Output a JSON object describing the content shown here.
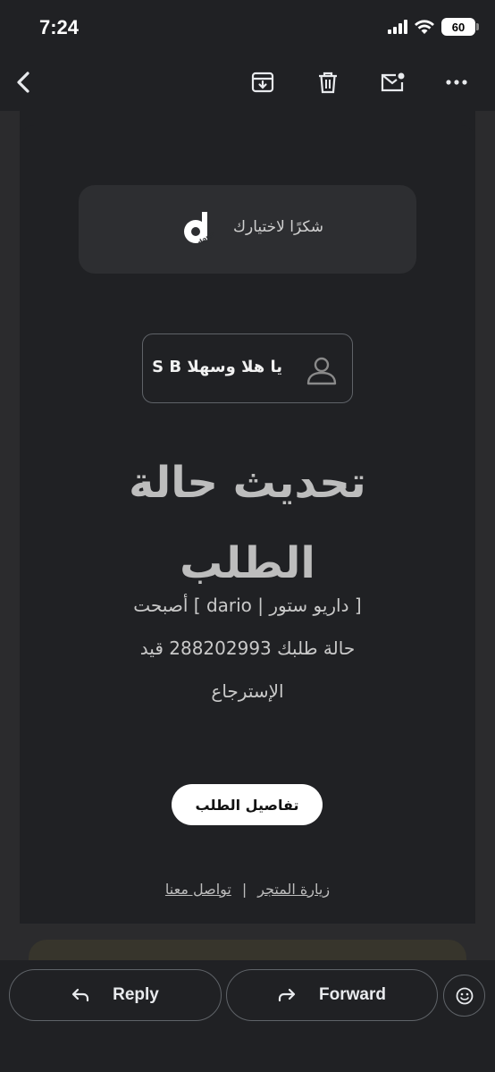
{
  "status_bar": {
    "time": "7:24",
    "battery": "60"
  },
  "email": {
    "brand_tagline": "شكرًا لاختيارك",
    "brand_logo_text": "dario",
    "greeting": "يا هلا وسهلا S B",
    "heading_line1": "تحديث حالة",
    "heading_line2": "الطلب",
    "body_line1": "[ داريو ستور | dario ] أصبحت",
    "body_line2": "حالة طلبك 288202993 قيد",
    "body_line3": "الإسترجاع",
    "details_button": "تفاصيل الطلب",
    "footer_link_store": "زيارة المتجر",
    "footer_separator": "|",
    "footer_link_contact": "تواصل معنا"
  },
  "actions": {
    "reply": "Reply",
    "forward": "Forward"
  }
}
